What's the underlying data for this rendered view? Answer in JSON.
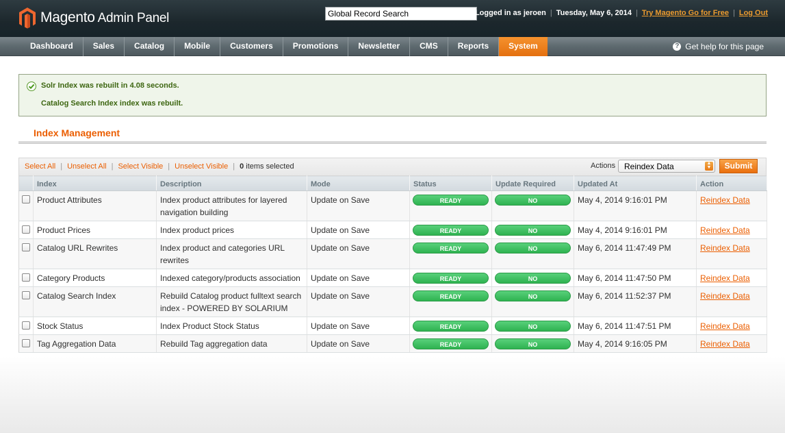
{
  "header": {
    "logo_text": "Magento",
    "logo_subtext": "Admin Panel",
    "search_value": "Global Record Search",
    "logged_in": "Logged in as jeroen",
    "date": "Tuesday, May 6, 2014",
    "try_link": "Try Magento Go for Free",
    "logout_link": "Log Out"
  },
  "nav": {
    "items": [
      {
        "label": "Dashboard"
      },
      {
        "label": "Sales"
      },
      {
        "label": "Catalog"
      },
      {
        "label": "Mobile"
      },
      {
        "label": "Customers"
      },
      {
        "label": "Promotions"
      },
      {
        "label": "Newsletter"
      },
      {
        "label": "CMS"
      },
      {
        "label": "Reports"
      },
      {
        "label": "System"
      }
    ],
    "help": "Get help for this page"
  },
  "messages": [
    "Solr Index was rebuilt in 4.08 seconds.",
    "Catalog Search Index index was rebuilt."
  ],
  "page": {
    "title": "Index Management"
  },
  "massaction": {
    "select_all": "Select All",
    "unselect_all": "Unselect All",
    "select_visible": "Select Visible",
    "unselect_visible": "Unselect Visible",
    "selected_count": "0",
    "selected_label": "items selected",
    "actions_label": "Actions",
    "actions_value": "Reindex Data",
    "submit": "Submit"
  },
  "grid": {
    "columns": [
      "Index",
      "Description",
      "Mode",
      "Status",
      "Update Required",
      "Updated At",
      "Action"
    ],
    "rows": [
      {
        "index": "Product Attributes",
        "description": "Index product attributes for layered navigation building",
        "mode": "Update on Save",
        "status": "READY",
        "update_required": "NO",
        "updated_at": "May 4, 2014 9:16:01 PM",
        "action": "Reindex Data"
      },
      {
        "index": "Product Prices",
        "description": "Index product prices",
        "mode": "Update on Save",
        "status": "READY",
        "update_required": "NO",
        "updated_at": "May 4, 2014 9:16:01 PM",
        "action": "Reindex Data"
      },
      {
        "index": "Catalog URL Rewrites",
        "description": "Index product and categories URL rewrites",
        "mode": "Update on Save",
        "status": "READY",
        "update_required": "NO",
        "updated_at": "May 6, 2014 11:47:49 PM",
        "action": "Reindex Data"
      },
      {
        "index": "Category Products",
        "description": "Indexed category/products association",
        "mode": "Update on Save",
        "status": "READY",
        "update_required": "NO",
        "updated_at": "May 6, 2014 11:47:50 PM",
        "action": "Reindex Data"
      },
      {
        "index": "Catalog Search Index",
        "description": "Rebuild Catalog product fulltext search index - POWERED BY SOLARIUM",
        "mode": "Update on Save",
        "status": "READY",
        "update_required": "NO",
        "updated_at": "May 6, 2014 11:52:37 PM",
        "action": "Reindex Data"
      },
      {
        "index": "Stock Status",
        "description": "Index Product Stock Status",
        "mode": "Update on Save",
        "status": "READY",
        "update_required": "NO",
        "updated_at": "May 6, 2014 11:47:51 PM",
        "action": "Reindex Data"
      },
      {
        "index": "Tag Aggregation Data",
        "description": "Rebuild Tag aggregation data",
        "mode": "Update on Save",
        "status": "READY",
        "update_required": "NO",
        "updated_at": "May 4, 2014 9:16:05 PM",
        "action": "Reindex Data"
      }
    ]
  }
}
